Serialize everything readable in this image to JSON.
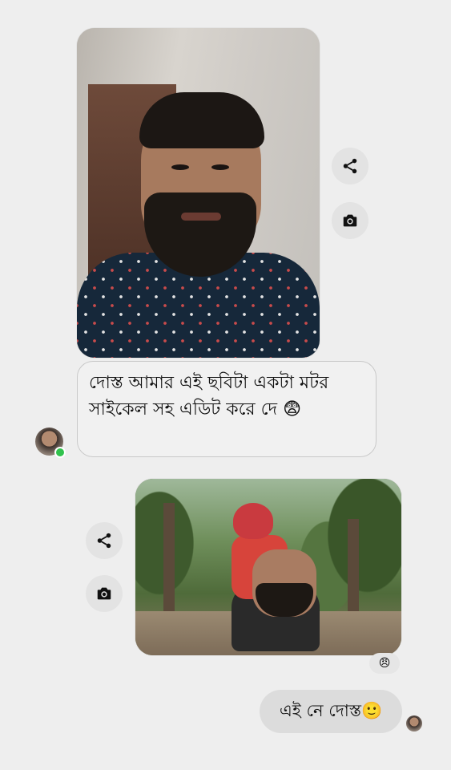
{
  "conversation": {
    "incoming_message": "দোস্ত আমার এই ছবিটা একটা মটর সাইকেল সহ এডিট করে দে 😨",
    "outgoing_message": "এই নে দোস্ত🙂",
    "reaction_emoji": "😠"
  },
  "icons": {
    "share": "share-icon",
    "camera": "camera-icon"
  },
  "colors": {
    "background": "#eeeeee",
    "incoming_bubble": "#f1f1f1",
    "outgoing_bubble": "#dcdcdc",
    "online_indicator": "#31c24d"
  }
}
